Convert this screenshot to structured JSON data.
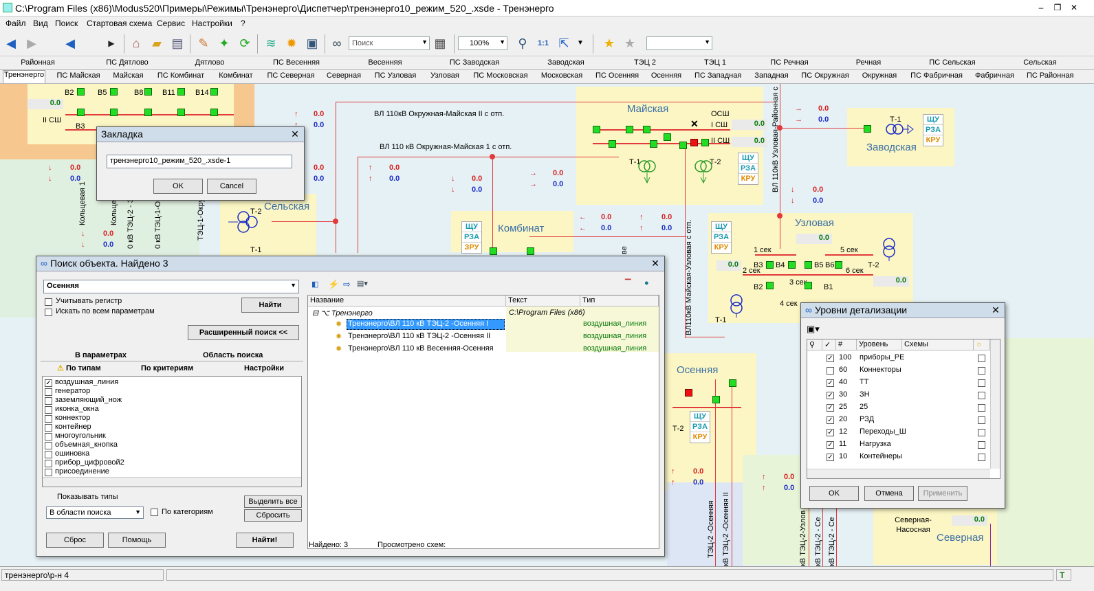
{
  "window": {
    "title": "C:\\Program Files (x86)\\Modus520\\Примеры\\Режимы\\Тренэнерго\\Диспетчер\\тренэнерго10_режим_520_.xsde - Тренэнерго",
    "min_label": "–",
    "restore_label": "❐",
    "close_label": "✕"
  },
  "menu": [
    "Файл",
    "Вид",
    "Поиск",
    "Стартовая схема",
    "Сервис",
    "Настройки",
    "?"
  ],
  "toolbar": {
    "search_placeholder": "Поиск",
    "zoom": "100%"
  },
  "tabs_row1": [
    "Районная",
    "ПС Дятлово",
    "Дятлово",
    "ПС Весенняя",
    "Весенняя",
    "ПС Заводская",
    "Заводская",
    "ТЭЦ 2",
    "ТЭЦ 1",
    "ПС Речная",
    "Речная",
    "ПС Сельская",
    "Сельская"
  ],
  "tabs_row2": [
    "Тренэнерго",
    "ПС Майская",
    "Майская",
    "ПС Комбинат",
    "Комбинат",
    "ПС Северная",
    "Северная",
    "ПС Узловая",
    "Узловая",
    "ПС Московская",
    "Московская",
    "ПС Осенняя",
    "Осенняя",
    "ПС Западная",
    "Западная",
    "ПС Окружная",
    "Окружная",
    "ПС Фабричная",
    "Фабричная",
    "ПС Районная"
  ],
  "scheme": {
    "stations": {
      "mayskaya": "Майская",
      "zavodskaya": "Заводская",
      "selskaya": "Сельская",
      "kombinat": "Комбинат",
      "uzlovaya": "Узловая",
      "osennyaya": "Осенняя",
      "severnaya": "Северная",
      "severnaya_nasosnaya": "Северная-Насосная"
    },
    "line_labels": {
      "okr_may_2": "ВЛ 110кВ Окружная-Майская II с отп.",
      "okr_may_1": "ВЛ 110 кВ Окружная-Майская 1 с отп.",
      "uzl_ray": "ВЛ 110кВ Узловая-Районная с",
      "may_uzl": "ВЛ110кВ Майская-Узловая с отп.",
      "kolts": "Кольцевая 1",
      "kolts2": "Кольце",
      "tec2_3": "0 кВ ТЭЦ-2 - З",
      "tec1_ok": "0 кВ ТЭЦ-1-Ок",
      "tec1_okr": "ТЭЦ-1-Окружн",
      "osen_v1": "ТЭЦ-2 -Осенняя",
      "osen_v2": "кВ ТЭЦ-2 -Осенняя II",
      "bot1": "кВ ТЭЦ-2-Узлов",
      "bot2": "кВ ТЭЦ-2 - Се",
      "bot3": "кВ ТЭЦ-2 - Се",
      "bot4": "кВ ТЭЦ-2 - Се"
    },
    "bus_labels": {
      "osh": "ОСШ",
      "sh1": "I СШ",
      "sh2": "II СШ",
      "sh2_left": "II СШ",
      "sek1": "1 сек",
      "sek2": "2 сек",
      "sek3": "3 сек",
      "sek4": "4 сек",
      "sek5": "5 сек",
      "sek6": "6 сек"
    },
    "breakers": {
      "b2": "В2",
      "b5": "В5",
      "b8": "В8",
      "b11": "В11",
      "b14": "В14",
      "b3": "В3",
      "u_b3": "В3",
      "u_b4": "В4",
      "u_b5": "В5",
      "u_b6": "В6",
      "u_b2": "В2",
      "u_b1": "В1"
    },
    "transformers": {
      "t1": "Т-1",
      "t2": "Т-2"
    },
    "control": {
      "shu": "ЩУ",
      "rza": "РЗА",
      "kru": "КРУ",
      "zru": "ЗРУ"
    },
    "zero": "0.0",
    "up_arrow": "↑",
    "down_arrow": "↓",
    "right_arrow": "→",
    "left_arrow": "←",
    "x_mark": "✕",
    "vl_osen_right": "ве"
  },
  "bookmark_dialog": {
    "title": "Закладка",
    "value": "тренэнерго10_режим_520_.xsde-1",
    "ok": "OK",
    "cancel": "Cancel"
  },
  "search_dialog": {
    "title": "Поиск объекта. Найдено 3",
    "query": "Осенняя",
    "case_label": "Учитывать регистр",
    "allparams_label": "Искать по всем параметрам",
    "find_button": "Найти",
    "advanced_button": "Расширенный поиск <<",
    "tabs_top": [
      "В параметрах",
      "Область поиска"
    ],
    "tabs_bottom": [
      "По типам",
      "По критериям",
      "Настройки"
    ],
    "types": [
      {
        "label": "воздушная_линия",
        "checked": true
      },
      {
        "label": "генератор",
        "checked": false
      },
      {
        "label": "заземляющий_нож",
        "checked": false
      },
      {
        "label": "иконка_окна",
        "checked": false
      },
      {
        "label": "коннектор",
        "checked": false
      },
      {
        "label": "контейнер",
        "checked": false
      },
      {
        "label": "многоугольник",
        "checked": false
      },
      {
        "label": "объемная_кнопка",
        "checked": false
      },
      {
        "label": "ошиновка",
        "checked": false
      },
      {
        "label": "прибор_цифровой2",
        "checked": false
      },
      {
        "label": "присоединение",
        "checked": false
      }
    ],
    "show_types_label": "Показывать типы",
    "show_types_value": "В области поиска",
    "by_category_label": "По категориям",
    "select_all": "Выделить все",
    "reset_sel": "Сбросить",
    "reset": "Сброс",
    "help": "Помощь",
    "find2": "Найти!",
    "result_headers": [
      "Название",
      "Текст",
      "Тип"
    ],
    "root": "Тренэнерго",
    "root_text": "C:\\Program Files (x86)",
    "results": [
      {
        "name": "Тренэнерго\\ВЛ 110 кВ ТЭЦ-2 -Осенняя I",
        "type": "воздушная_линия"
      },
      {
        "name": "Тренэнерго\\ВЛ 110 кВ ТЭЦ-2 -Осенняя II",
        "type": "воздушная_линия"
      },
      {
        "name": "Тренэнерго\\ВЛ 110 кВ Весенняя-Осенняя",
        "type": "воздушная_линия"
      }
    ],
    "found": "Найдено: 3",
    "viewed": "Просмотрено схем:"
  },
  "levels_dialog": {
    "title": "Уровни детализации",
    "headers": [
      "#",
      "Уровень",
      "Схемы"
    ],
    "rows": [
      {
        "n": "100",
        "name": "приборы_РЕ",
        "checked": true
      },
      {
        "n": "60",
        "name": "Коннекторы",
        "checked": false
      },
      {
        "n": "40",
        "name": "ТТ",
        "checked": true
      },
      {
        "n": "30",
        "name": "ЗН",
        "checked": true
      },
      {
        "n": "25",
        "name": "25",
        "checked": true
      },
      {
        "n": "20",
        "name": "РЗД",
        "checked": true
      },
      {
        "n": "12",
        "name": "Переходы_Ш",
        "checked": true
      },
      {
        "n": "11",
        "name": "Нагрузка",
        "checked": true
      },
      {
        "n": "10",
        "name": "Контейнеры",
        "checked": true
      }
    ],
    "ok": "OK",
    "cancel": "Отмена",
    "apply": "Применить"
  },
  "statusbar": {
    "left": "тренэнерго\\р-н 4",
    "right_icon": "T"
  }
}
